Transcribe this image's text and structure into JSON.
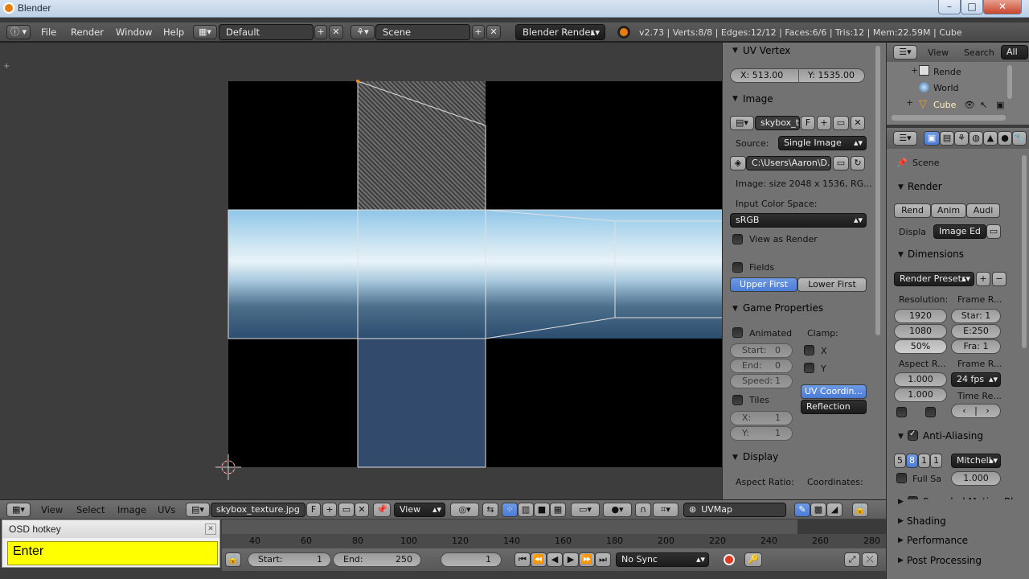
{
  "window": {
    "title": "Blender"
  },
  "info_header": {
    "menus": [
      "File",
      "Render",
      "Window",
      "Help"
    ],
    "layout": "Default",
    "scene": "Scene",
    "engine": "Blender Render",
    "stats": "v2.73 | Verts:8/8 | Edges:12/12 | Faces:6/6 | Tris:12 | Mem:22.59M | Cube"
  },
  "uv_vertex": {
    "title": "UV Vertex",
    "x": "X: 513.00",
    "y": "Y: 1535.00"
  },
  "image_panel": {
    "title": "Image",
    "image_name": "skybox_t",
    "f_label": "F",
    "source_label": "Source:",
    "source_value": "Single Image",
    "filepath": "C:\\Users\\Aaron\\D...",
    "size_info": "Image: size 2048 x 1536, RG...",
    "color_space_label": "Input Color Space:",
    "color_space": "sRGB",
    "view_as_render": "View as Render",
    "fields": "Fields",
    "upper_first": "Upper First",
    "lower_first": "Lower First"
  },
  "game_properties": {
    "title": "Game Properties",
    "animated": "Animated",
    "clamp": "Clamp:",
    "start": "Start:",
    "start_val": "0",
    "end": "End:",
    "end_val": "0",
    "speed": "Speed:",
    "speed_val": "1",
    "clamp_x": "X",
    "clamp_y": "Y",
    "tiles": "Tiles",
    "tiles_x": "X:",
    "tiles_x_val": "1",
    "tiles_y": "Y:",
    "tiles_y_val": "1",
    "uv_coord": "UV Coordin...",
    "reflection": "Reflection"
  },
  "display_panel": {
    "title": "Display",
    "aspect_ratio": "Aspect Ratio:",
    "coordinates": "Coordinates:"
  },
  "outliner": {
    "header": [
      "View",
      "Search",
      "All"
    ],
    "items": [
      "Rende",
      "World",
      "Cube"
    ]
  },
  "properties": {
    "scene": "Scene",
    "render_title": "Render",
    "render_btns": [
      "Rend",
      "Anim",
      "Audi"
    ],
    "display_label": "Displa",
    "display_value": "Image Ed",
    "dimensions_title": "Dimensions",
    "render_presets": "Render Presets",
    "resolution_label": "Resolution:",
    "frame_range_label": "Frame R...",
    "res_x": "1920",
    "res_y": "1080",
    "res_pct": "50%",
    "frame_start": "Star: 1",
    "frame_end": "E:250",
    "frame_step": "Fra: 1",
    "aspect_label": "Aspect R...",
    "framerate_label": "Frame R...",
    "aspect_x": "1.000",
    "aspect_y": "1.000",
    "fps": "24 fps",
    "time_remap": "Time Re...",
    "aa_title": "Anti-Aliasing",
    "aa_samples": [
      "5",
      "8",
      "1",
      "1"
    ],
    "aa_filter": "Mitchell-",
    "full_sample": "Full Sa",
    "aa_size": "1.000",
    "motion_blur": "Sampled Motion Bl",
    "shading": "Shading",
    "performance": "Performance",
    "post_processing": "Post Processing"
  },
  "uv_header": {
    "menus": [
      "View",
      "Select",
      "Image",
      "UVs"
    ],
    "image_name": "skybox_texture.jpg",
    "f_label": "F",
    "view_mode": "View",
    "uv_map": "UVMap"
  },
  "timeline": {
    "ticks": [
      "40",
      "60",
      "80",
      "100",
      "120",
      "140",
      "160",
      "180",
      "200",
      "220",
      "240",
      "260",
      "280"
    ],
    "start_label": "Start:",
    "start_val": "1",
    "end_label": "End:",
    "end_val": "250",
    "current": "1",
    "sync": "No Sync"
  },
  "osd": {
    "title": "OSD hotkey",
    "text": "Enter"
  }
}
